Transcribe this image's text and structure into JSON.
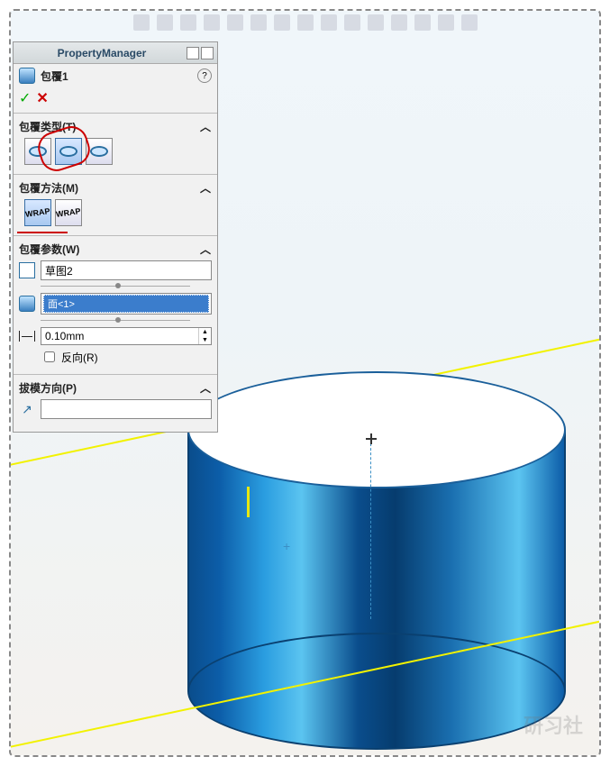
{
  "viewport": {
    "watermark": "研习社"
  },
  "pm": {
    "title": "PropertyManager",
    "feature_name": "包覆1",
    "help_char": "?",
    "confirm": {
      "ok": "✓",
      "cancel": "✕"
    },
    "sections": {
      "wrap_type": {
        "label": "包覆类型(T)"
      },
      "wrap_method": {
        "label": "包覆方法(M)",
        "btn1": "WRAP",
        "btn2": "WRAP"
      },
      "params": {
        "label": "包覆参数(W)",
        "sketch_value": "草图2",
        "face_value": "面<1>",
        "dim_value": "0.10mm",
        "reverse_label": "反向(R)"
      },
      "draft": {
        "label": "拔模方向(P)",
        "value": ""
      }
    }
  }
}
